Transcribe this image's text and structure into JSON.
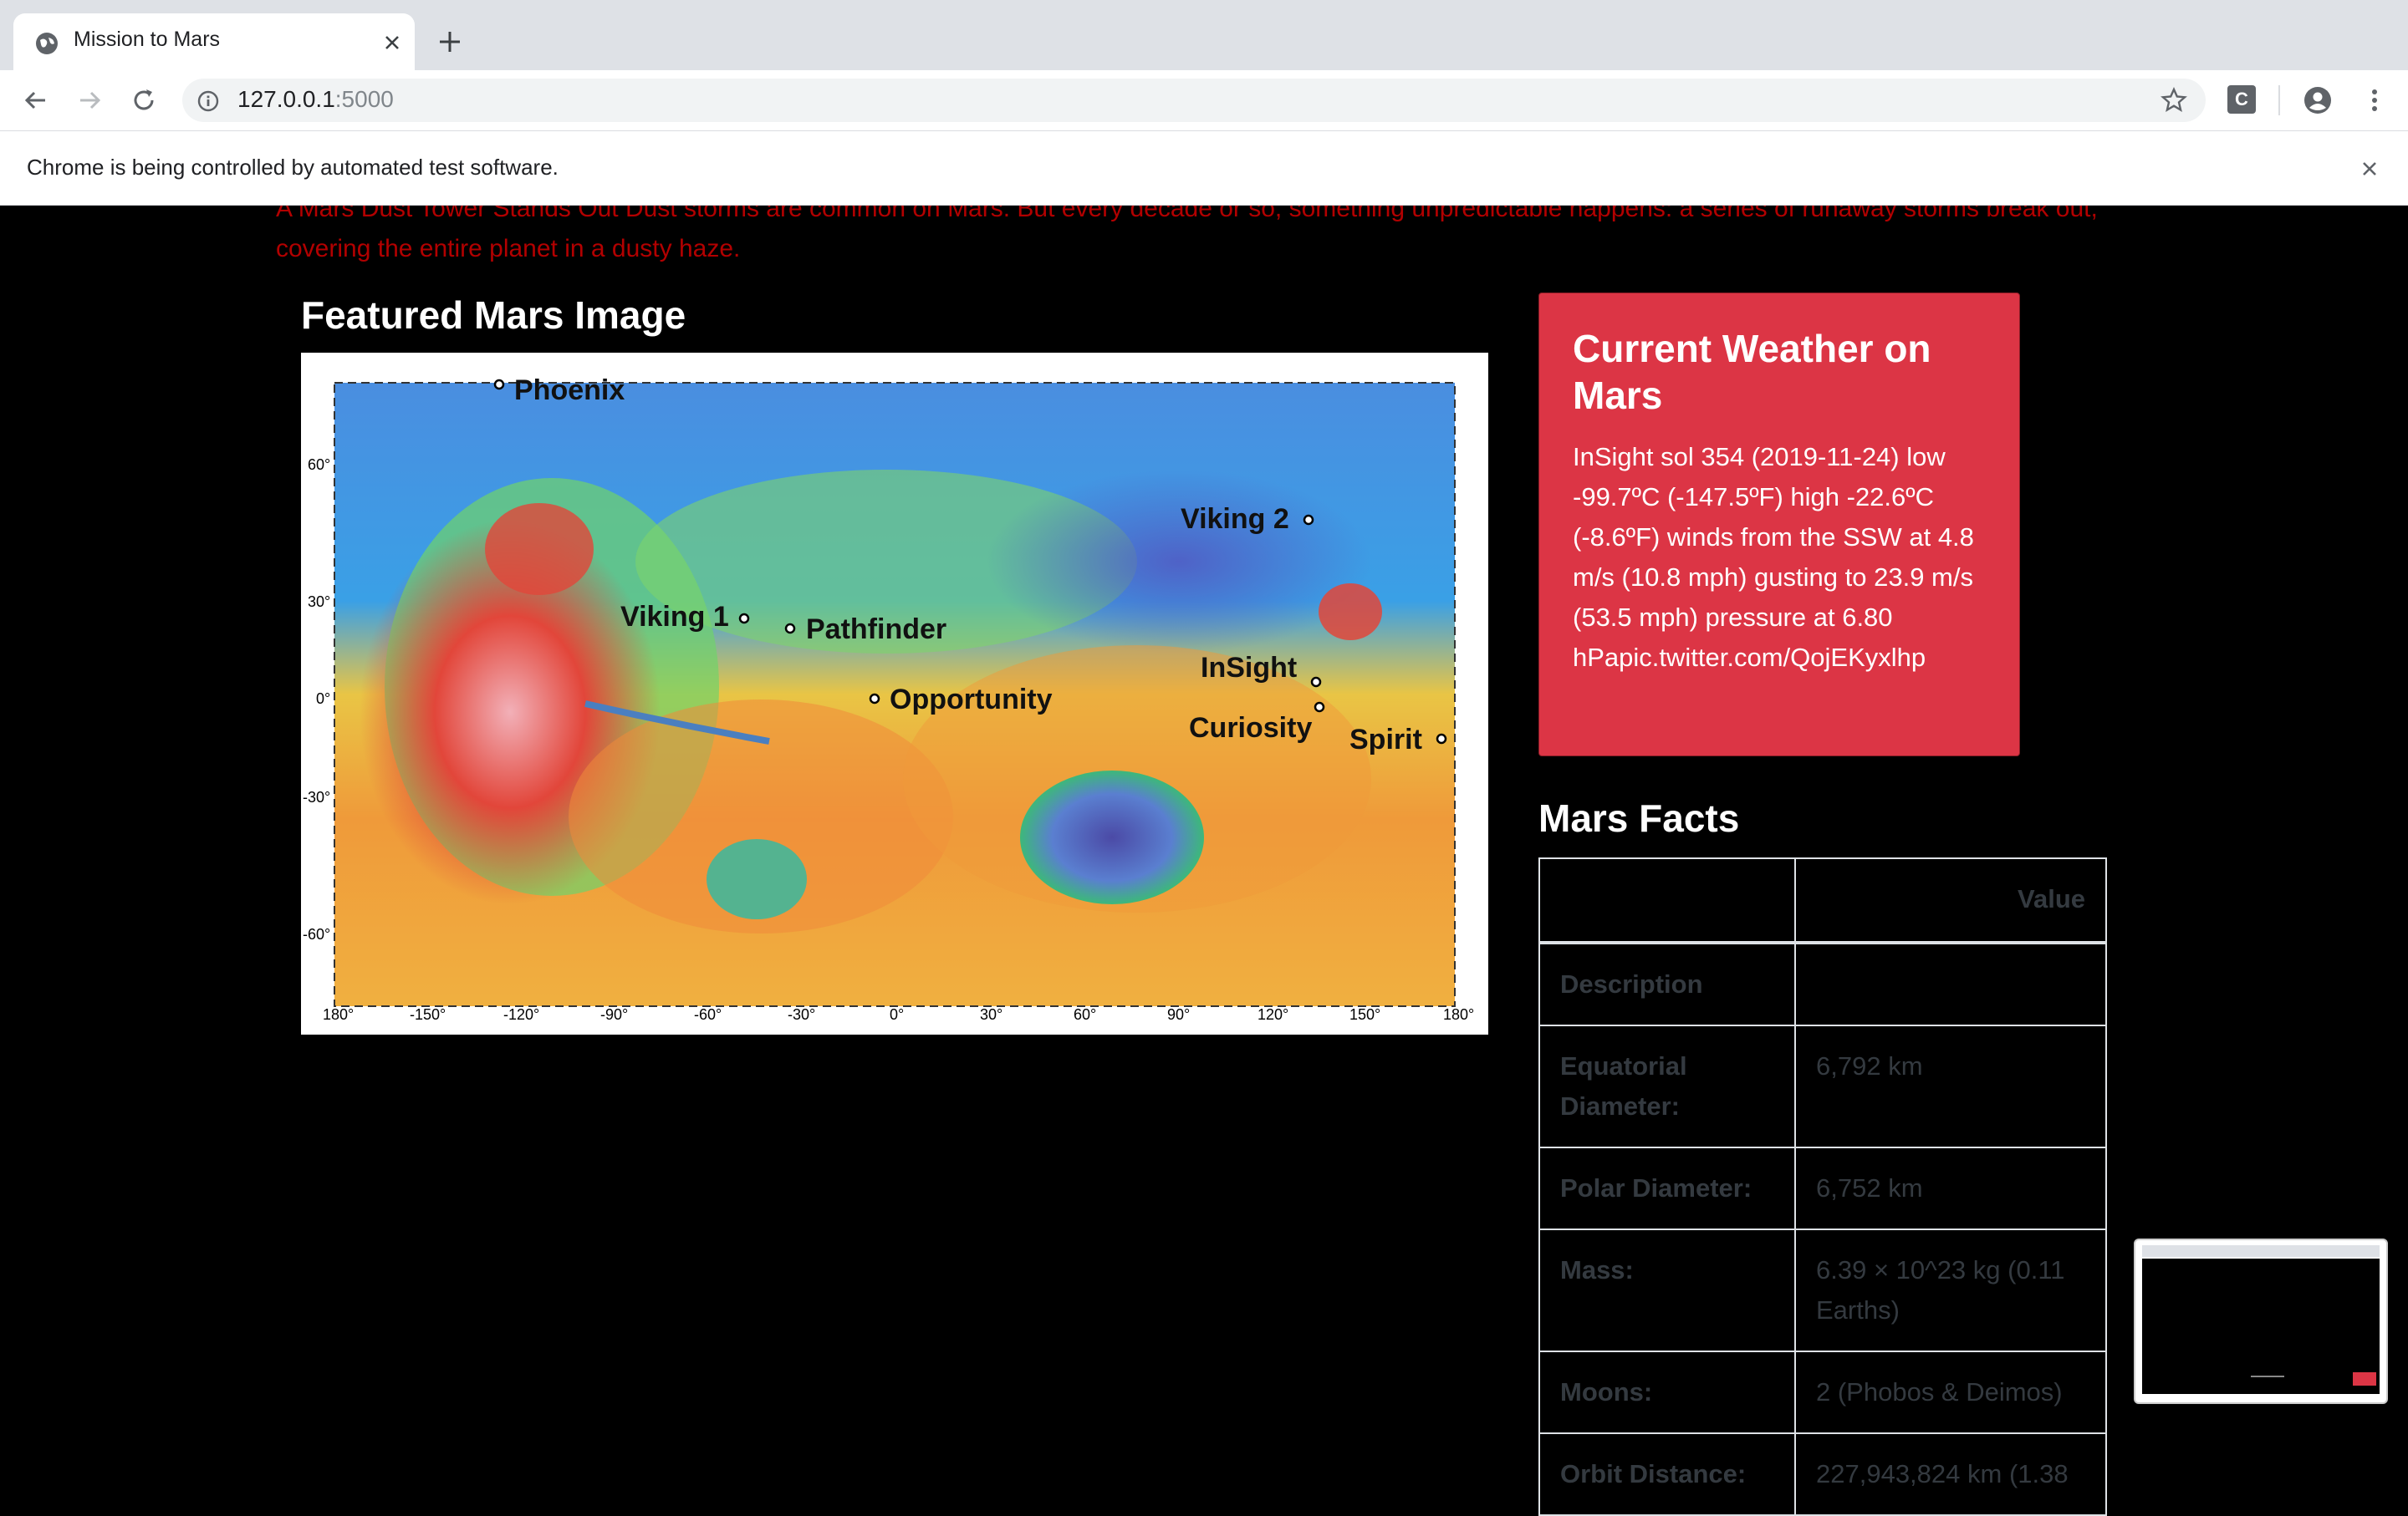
{
  "browser": {
    "tab_title": "Mission to Mars",
    "url_host": "127.0.0.1",
    "url_port": ":5000",
    "extension_letter": "C",
    "infobar_text": "Chrome is being controlled by automated test software."
  },
  "news": {
    "paragraph": "A Mars Dust Tower Stands Out Dust storms are common on Mars. But every decade or so, something unpredictable happens: a series of runaway storms break out, covering the entire planet in a dusty haze."
  },
  "featured": {
    "heading": "Featured Mars Image",
    "map_sites": [
      "Phoenix",
      "Viking 2",
      "Viking 1",
      "Pathfinder",
      "Opportunity",
      "InSight",
      "Curiosity",
      "Spirit"
    ],
    "lat_ticks": [
      "60°",
      "30°",
      "0°",
      "-30°",
      "-60°"
    ],
    "lon_ticks": [
      "180°",
      "-150°",
      "-120°",
      "-90°",
      "-60°",
      "-30°",
      "0°",
      "30°",
      "60°",
      "90°",
      "120°",
      "150°",
      "180°"
    ]
  },
  "weather": {
    "heading": "Current Weather on Mars",
    "text": "InSight sol 354 (2019-11-24) low -99.7ºC (-147.5ºF) high -22.6ºC (-8.6ºF) winds from the SSW at 4.8 m/s (10.8 mph) gusting to 23.9 m/s (53.5 mph) pressure at 6.80 hPapic.twitter.com/QojEKyxlhp"
  },
  "facts": {
    "heading": "Mars Facts",
    "header_value": "Value",
    "rows": [
      {
        "label": "Description",
        "value": ""
      },
      {
        "label": "Equatorial Diameter:",
        "value": "6,792 km"
      },
      {
        "label": "Polar Diameter:",
        "value": "6,752 km"
      },
      {
        "label": "Mass:",
        "value": "6.39 × 10^23 kg (0.11 Earths)"
      },
      {
        "label": "Moons:",
        "value": "2 (Phobos & Deimos)"
      },
      {
        "label": "Orbit Distance:",
        "value": "227,943,824 km (1.38"
      }
    ]
  }
}
